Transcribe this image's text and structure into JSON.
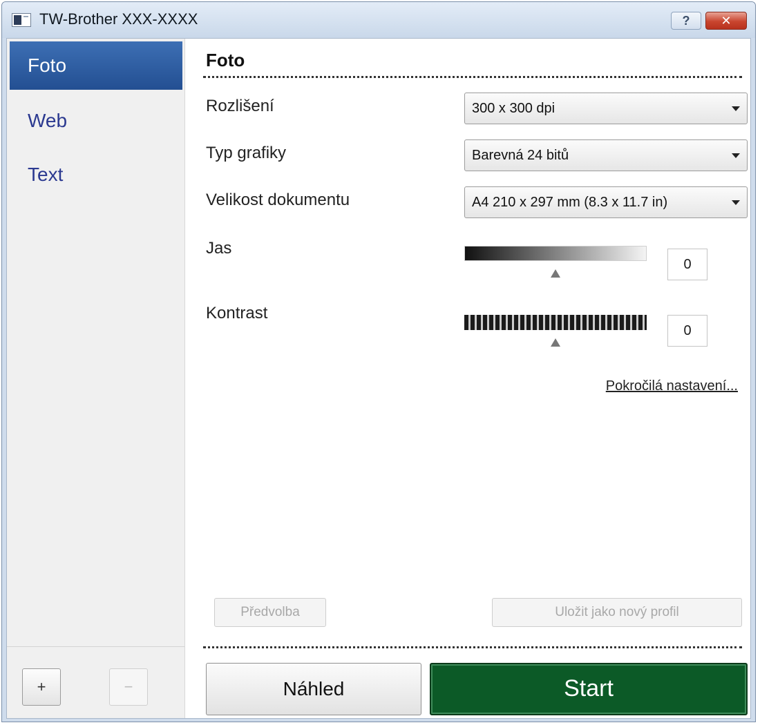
{
  "window": {
    "title": "TW-Brother XXX-XXXX",
    "help_label": "?",
    "close_label": "✕"
  },
  "sidebar": {
    "items": [
      {
        "label": "Foto",
        "selected": true
      },
      {
        "label": "Web",
        "selected": false
      },
      {
        "label": "Text",
        "selected": false
      }
    ],
    "add_label": "+",
    "remove_label": "−"
  },
  "main": {
    "title": "Foto",
    "resolution": {
      "label": "Rozlišení",
      "value": "300 x 300 dpi"
    },
    "image_type": {
      "label": "Typ grafiky",
      "value": "Barevná 24 bitů"
    },
    "document_size": {
      "label": "Velikost dokumentu",
      "value": "A4 210 x 297 mm (8.3 x 11.7 in)"
    },
    "brightness": {
      "label": "Jas",
      "value": "0",
      "level": 0.5
    },
    "contrast": {
      "label": "Kontrast",
      "value": "0",
      "level": 0.5
    },
    "advanced_link": "Pokročilá nastavení...",
    "preset_button": "Předvolba",
    "save_profile_button": "Uložit jako nový profil",
    "preview_button": "Náhled",
    "start_button": "Start"
  },
  "colors": {
    "selected_item": "#2f5fa5",
    "nav_text": "#2b3990",
    "start_button": "#0c5a27",
    "close_button": "#c9452f"
  }
}
